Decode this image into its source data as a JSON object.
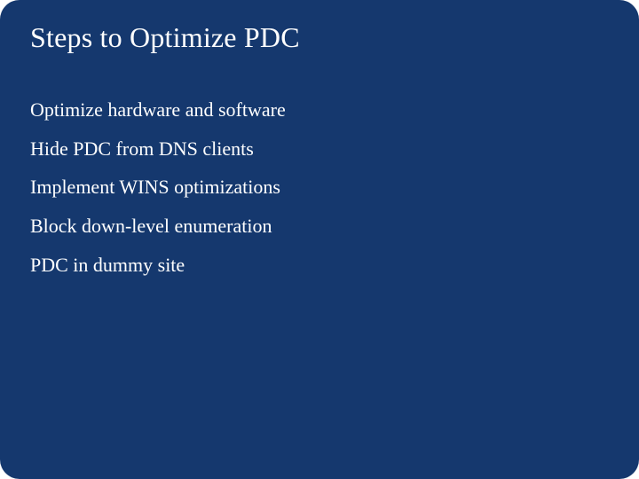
{
  "slide": {
    "title": "Steps to Optimize PDC",
    "items": [
      "Optimize hardware and software",
      "Hide PDC from DNS clients",
      "Implement WINS optimizations",
      "Block down-level enumeration",
      "PDC in dummy site"
    ]
  }
}
